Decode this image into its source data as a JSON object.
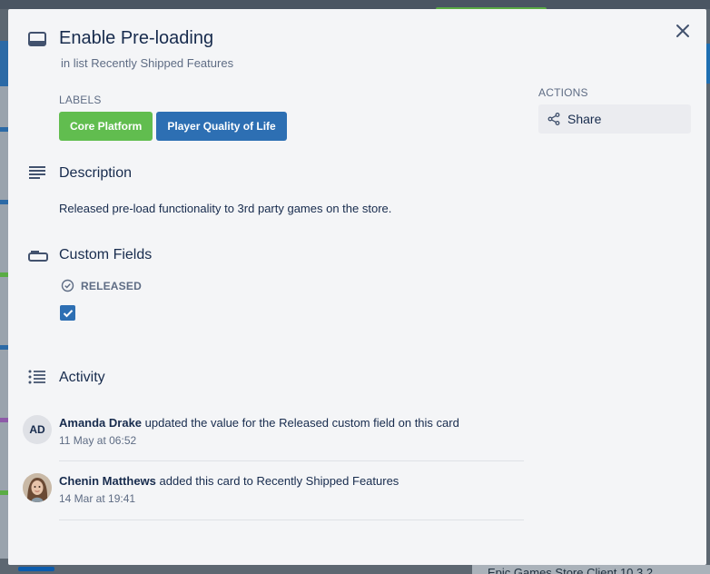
{
  "card": {
    "title": "Enable Pre-loading",
    "in_list_prefix": "in list",
    "list_name": "Recently Shipped Features"
  },
  "labels": {
    "heading": "LABELS",
    "items": [
      {
        "text": "Core Platform",
        "color": "#61bd4f"
      },
      {
        "text": "Player Quality of Life",
        "color": "#2d6fb3"
      }
    ]
  },
  "actions": {
    "heading": "ACTIONS",
    "share_label": "Share"
  },
  "description": {
    "title": "Description",
    "text": "Released pre-load functionality to 3rd party games on the store."
  },
  "custom_fields": {
    "title": "Custom Fields",
    "field_name": "RELEASED",
    "checked": true
  },
  "activity": {
    "title": "Activity",
    "items": [
      {
        "initials": "AD",
        "user": "Amanda Drake",
        "action": "updated the value for the Released custom field on this card",
        "time": "11 May at 06:52"
      },
      {
        "initials": "",
        "user": "Chenin Matthews",
        "action": "added this card to Recently Shipped Features",
        "time": "14 Mar at 19:41"
      }
    ]
  },
  "background": {
    "bottom_card_text": "Epic Games Store Client 10.3.2"
  },
  "colors": {
    "accent": "#2d6fb3",
    "green_label": "#61bd4f"
  }
}
